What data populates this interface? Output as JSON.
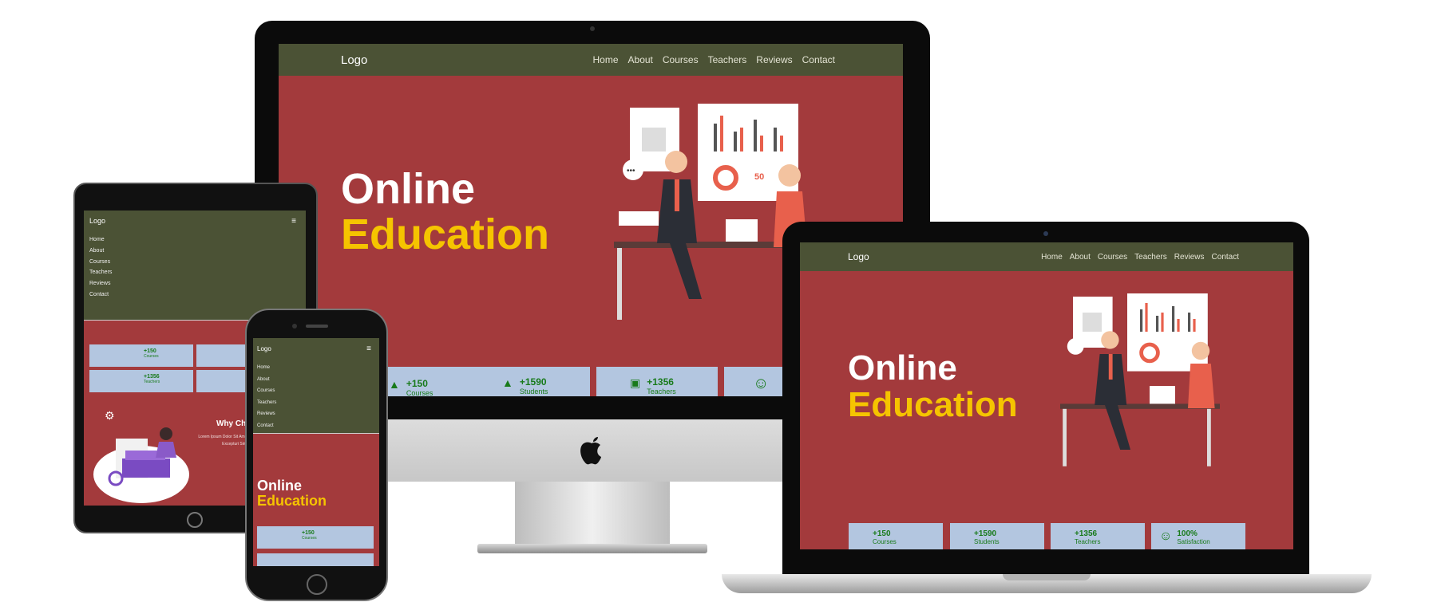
{
  "colors": {
    "nav": "#4b5235",
    "hero": "#a33a3c",
    "accent": "#f5c400",
    "card": "#b3c6e0",
    "card_text": "#187a1a"
  },
  "site": {
    "logo": "Logo",
    "nav": [
      "Home",
      "About",
      "Courses",
      "Teachers",
      "Reviews",
      "Contact"
    ],
    "hero_line1": "Online",
    "hero_line2": "Education",
    "stats": [
      {
        "icon": "graduation-cap-icon",
        "value": "+150",
        "label": "Courses"
      },
      {
        "icon": "graduation-cap-icon",
        "value": "+1590",
        "label": "Students"
      },
      {
        "icon": "teacher-board-icon",
        "value": "+1356",
        "label": "Teachers"
      },
      {
        "icon": "smile-icon",
        "value": "100%",
        "label": "Satisfaction"
      }
    ],
    "menu_icon": "hamburger-icon",
    "why_title": "Why Ch",
    "why_body": "Lorem Ipsum Dolor Sit Amet Veniam Quae Totam Sequi Excepturi Similique Laborum"
  },
  "devices": {
    "imac_brand_icon": "apple-logo-icon"
  }
}
